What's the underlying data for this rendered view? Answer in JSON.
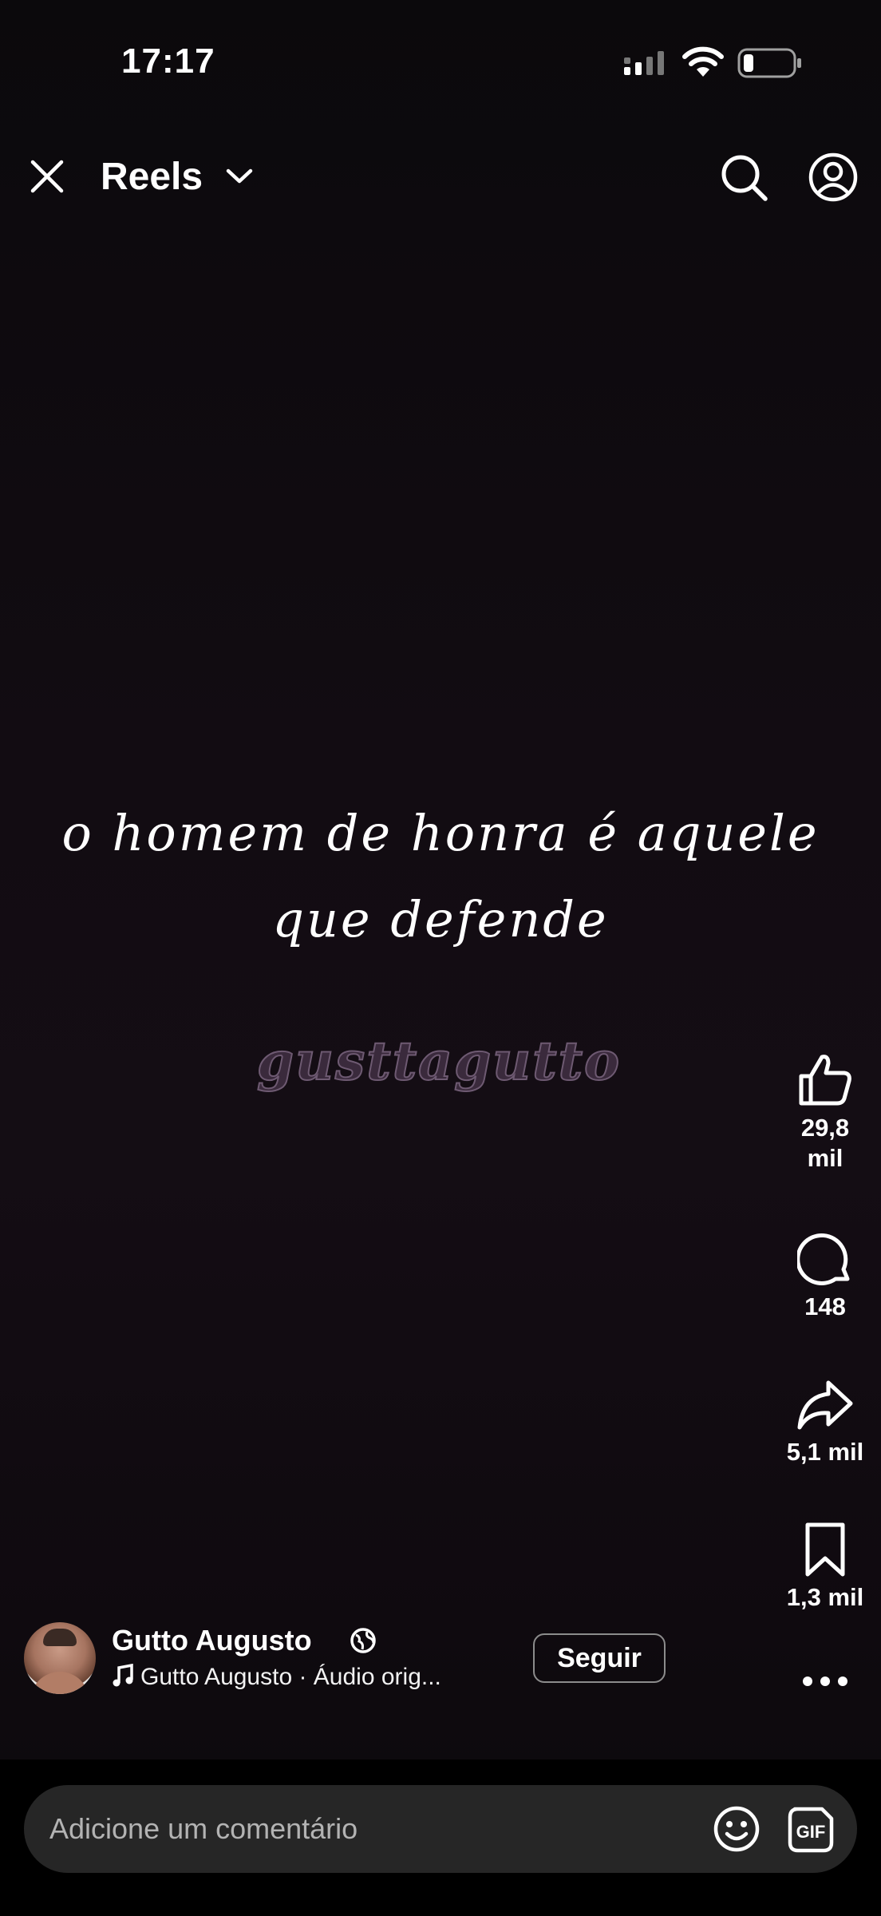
{
  "status_bar": {
    "time": "17:17",
    "icons": [
      "signal-icon",
      "wifi-icon",
      "battery-icon"
    ]
  },
  "header": {
    "title": "Reels",
    "icons": [
      "close-icon",
      "chevron-down-icon",
      "search-icon",
      "profile-icon"
    ]
  },
  "video": {
    "caption_line1": "o homem de honra é aquele",
    "caption_line2": "que defende",
    "watermark": "gusttagutto"
  },
  "actions": {
    "likes": "29,8 mil",
    "likes_line1": "29,8",
    "likes_line2": "mil",
    "comments": "148",
    "shares": "5,1 mil",
    "saves": "1,3 mil",
    "icons": [
      "like-icon",
      "comment-icon",
      "share-icon",
      "bookmark-icon",
      "more-icon"
    ]
  },
  "author": {
    "name": "Gutto Augusto",
    "audio": "Gutto Augusto · Áudio orig...",
    "follow_label": "Seguir"
  },
  "comment_bar": {
    "placeholder": "Adicione um comentário",
    "gif_label": "GIF"
  },
  "colors": {
    "background": "#120c12",
    "text": "#ffffff",
    "comment_bar": "#262626"
  }
}
